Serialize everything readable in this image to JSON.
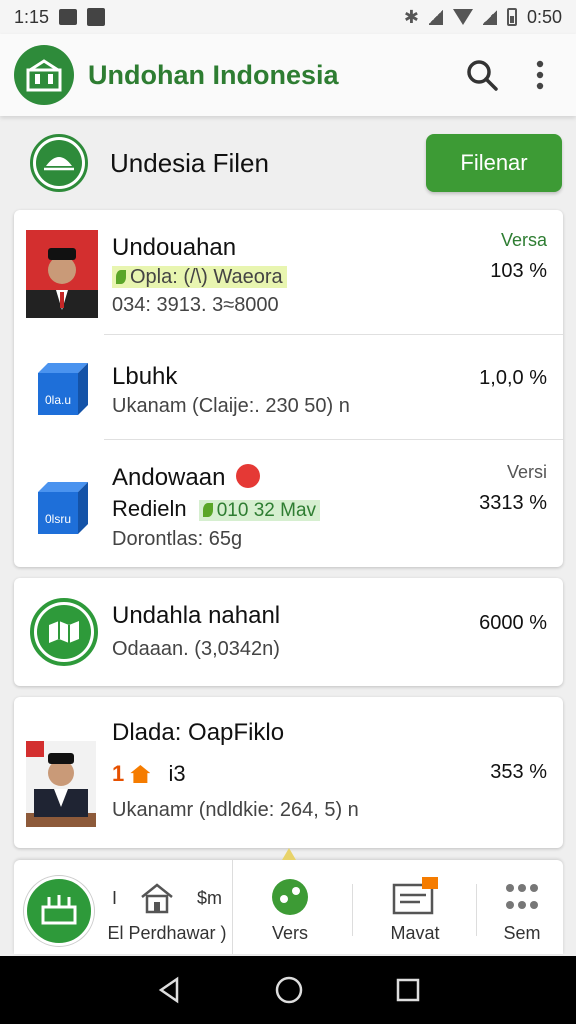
{
  "status_bar": {
    "time": "1:15",
    "clock": "0:50"
  },
  "app_bar": {
    "title": "Undohan Indonesia"
  },
  "sub_header": {
    "title": "Undesia Filen",
    "filter_label": "Filenar"
  },
  "list": {
    "card1": {
      "row1": {
        "title": "Undouahan",
        "tag": "Opla: (/\\) Waeora",
        "meta": "034: 3913. 3≈8000",
        "version_label": "Versa",
        "percent": "103 %"
      },
      "row2": {
        "title": "Lbuhk",
        "meta": "Ukanam (Claije:. 230 50) n",
        "percent": "1,0,0 %",
        "box_label": "0la.u"
      },
      "row3": {
        "title": "Andowaan",
        "sub_title": "Redieln",
        "tag": "010  32 Mav",
        "meta": "Dorontlas: 65g",
        "version_label": "Versi",
        "percent": "3313 %",
        "box_label": "0lsru"
      }
    },
    "card2": {
      "title": "Undahla nahanl",
      "meta": "Odaaan. (3,0342n)",
      "percent": "6000 %"
    },
    "card3": {
      "title": "Dlada: OapFiklo",
      "badge": "1",
      "sub": "i3",
      "meta": "Ukanamr (ndldkie: 264, 5) n",
      "percent": "353 %"
    }
  },
  "bottom_nav": {
    "item1": {
      "label": "El Perdhawar )",
      "top_left": "I",
      "top_right": "$m"
    },
    "item2": {
      "label": "Vers"
    },
    "item3": {
      "label": "Mavat"
    },
    "item4": {
      "label": "Sem"
    }
  },
  "colors": {
    "brand_green": "#2e7d32",
    "button_green": "#3d9b35"
  },
  "icons": [
    "bluetooth-icon",
    "search-icon",
    "more-vert-icon",
    "home-icon",
    "chat-icon",
    "mail-icon",
    "grid-icon",
    "back-icon",
    "home-circle-icon",
    "recents-icon"
  ]
}
